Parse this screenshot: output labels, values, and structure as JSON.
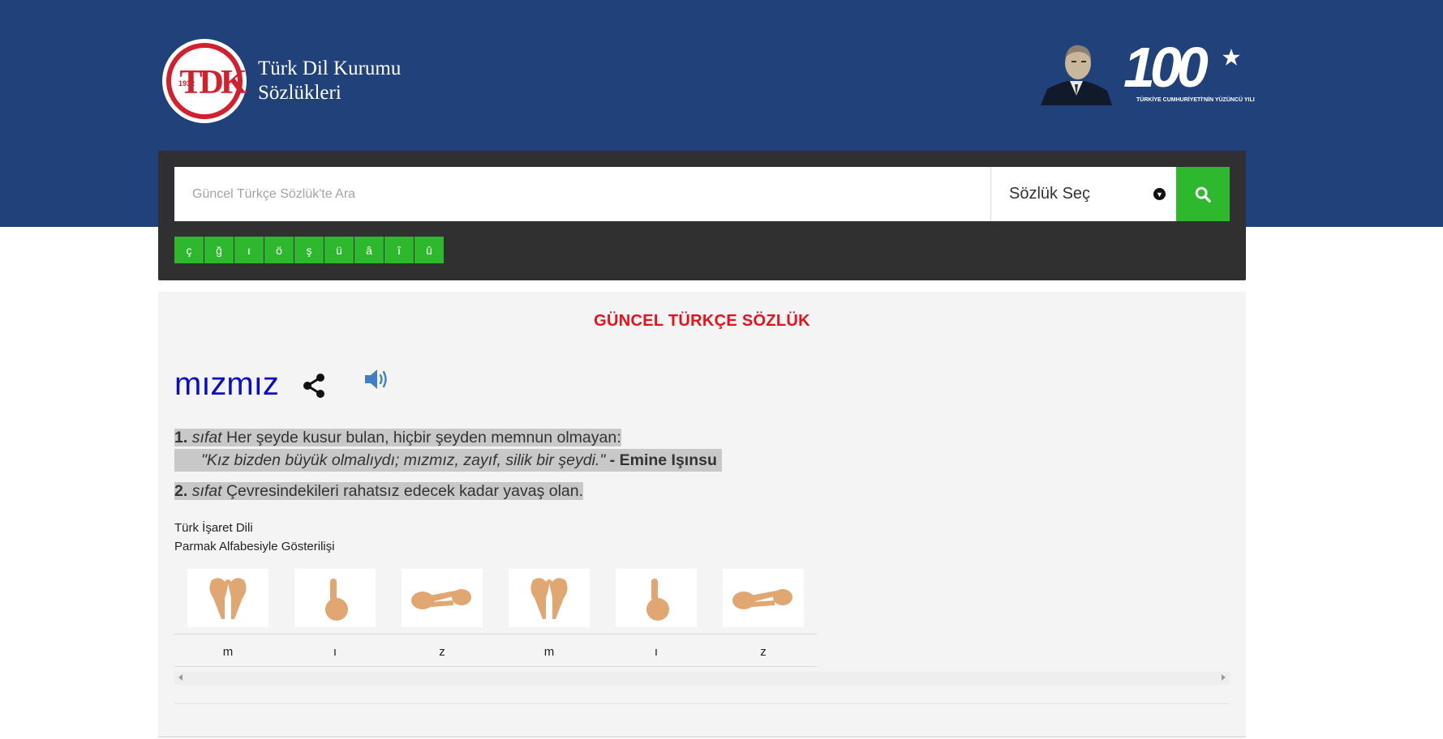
{
  "header": {
    "logo_year": "1932",
    "logo_letters": "TDK",
    "logo_line1": "Türk Dil Kurumu",
    "logo_line2": "Sözlükleri",
    "centennial_number": "100",
    "centennial_caption": "TÜRKİYE CUMHURİYETİ'NİN YÜZÜNCÜ YILI",
    "colors": {
      "band": "#21417b",
      "seal_red": "#d3202e"
    }
  },
  "search": {
    "placeholder": "Güncel Türkçe Sözlük'te Ara",
    "value": "",
    "dictionary_select": "Sözlük Seç",
    "search_icon": "search-icon",
    "special_chars": [
      "ç",
      "ğ",
      "ı",
      "ö",
      "ş",
      "ü",
      "â",
      "î",
      "û"
    ],
    "accent": "#2eb82e"
  },
  "result": {
    "dictionary_title": "GÜNCEL TÜRKÇE SÖZLÜK",
    "word": "mızmız",
    "meanings": [
      {
        "number": "1.",
        "pos": "sıfat",
        "definition": "Her şeyde kusur bulan, hiçbir şeyden memnun olmayan:",
        "example": "\"Kız bizden büyük olmalıydı; mızmız, zayıf, silik bir şeydi.\"",
        "example_sep": " - ",
        "example_author": "Emine Işınsu"
      },
      {
        "number": "2.",
        "pos": "sıfat",
        "definition": "Çevresindekileri rahatsız edecek kadar yavaş olan."
      }
    ],
    "sign_language_title": "Türk İşaret Dili",
    "sign_language_subtitle": "Parmak Alfabesiyle Gösterilişi",
    "sign_letters": [
      "m",
      "ı",
      "z",
      "m",
      "ı",
      "z"
    ],
    "word_color": "#0c0cc4",
    "title_color": "#e3121d"
  }
}
